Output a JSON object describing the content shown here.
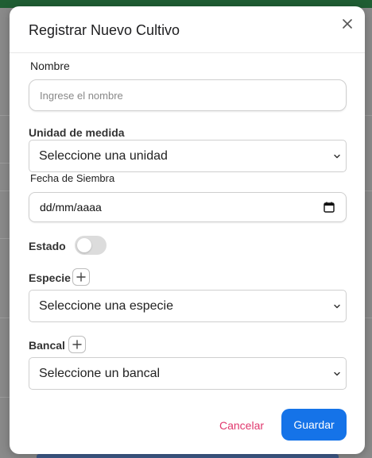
{
  "modal": {
    "title": "Registrar Nuevo Cultivo",
    "close_icon": "close-icon"
  },
  "fields": {
    "nombre": {
      "label": "Nombre",
      "placeholder": "Ingrese el nombre"
    },
    "unidad": {
      "label": "Unidad de medida",
      "value": "Seleccione una unidad"
    },
    "fecha": {
      "label": "Fecha de Siembra",
      "value": "dd/mm/aaaa",
      "icon": "calendar-icon"
    },
    "estado": {
      "label": "Estado",
      "on": false
    },
    "especie": {
      "label": "Especie",
      "value": "Seleccione una especie",
      "add_icon": "plus-icon"
    },
    "bancal": {
      "label": "Bancal",
      "value": "Seleccione un bancal",
      "add_icon": "plus-icon"
    }
  },
  "actions": {
    "cancel_label": "Cancelar",
    "save_label": "Guardar"
  },
  "colors": {
    "primary": "#1573e8",
    "cancel": "#e0386d",
    "header_bar": "#1f5e33"
  }
}
